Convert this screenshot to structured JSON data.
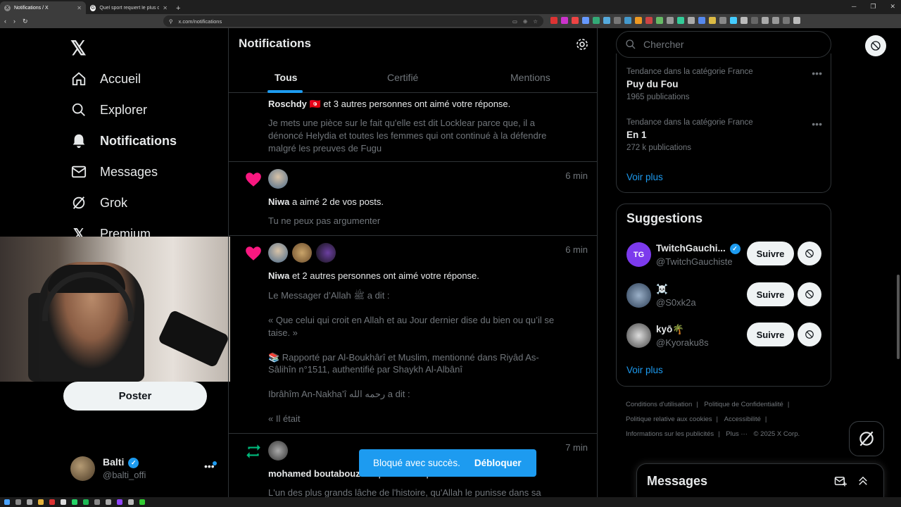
{
  "browser": {
    "tabs": [
      {
        "title": "Notifications / X",
        "active": true
      },
      {
        "title": "Quel sport requiert le plus de cardio",
        "active": false
      }
    ],
    "url": "x.com/notifications"
  },
  "nav": {
    "items": [
      {
        "label": "Accueil",
        "icon": "home-icon"
      },
      {
        "label": "Explorer",
        "icon": "search-icon"
      },
      {
        "label": "Notifications",
        "icon": "bell-icon",
        "active": true
      },
      {
        "label": "Messages",
        "icon": "mail-icon"
      },
      {
        "label": "Grok",
        "icon": "grok-icon"
      },
      {
        "label": "Premium",
        "icon": "x-icon"
      }
    ],
    "post_label": "Poster",
    "account": {
      "name": "Balti",
      "handle": "@balti_offi",
      "verified": true
    }
  },
  "notifications": {
    "title": "Notifications",
    "tabs": [
      "Tous",
      "Certifié",
      "Mentions"
    ],
    "active_tab": "Tous",
    "items": [
      {
        "type": "like",
        "actor": "Roschdy",
        "flag": "🇹🇳",
        "action": " et 3 autres personnes ont aimé votre réponse.",
        "time": "",
        "body": "Je mets une pièce sur le fait qu'elle est dit Locklear parce que, il a dénoncé Helydia et toutes les femmes qui ont continué à la défendre malgré les preuves de Fugu"
      },
      {
        "type": "like",
        "actor": "Niwa",
        "action": " a aimé 2 de vos posts.",
        "time": "6 min",
        "body": "Tu ne peux pas argumenter"
      },
      {
        "type": "like",
        "actor": "Niwa",
        "action": " et 2 autres personnes ont aimé votre réponse.",
        "time": "6 min",
        "body": "Le Messager d’Allah ﷺ a dit :\n\n« Que celui qui croit en Allah et au Jour dernier dise du bien ou qu’il se taise. »\n\n📚 Rapporté par Al-Boukhârî et Muslim, mentionné dans Riyâd As-Sâlihîn n°1511, authentifié par Shaykh Al-Albânî\n\nIbrâhîm An-Nakha’î رحمه الله a dit :\n\n« Il était"
      },
      {
        "type": "repost",
        "actor": "mohamed boutabouz",
        "action": " a reposté votre post.",
        "time": "7 min",
        "body": "L'un des plus grands lâche de l'histoire, qu'Allah le punisse dans sa"
      }
    ]
  },
  "toast": {
    "message": "Bloqué avec succès.",
    "action": "Débloquer"
  },
  "sidebar": {
    "search_placeholder": "Chercher",
    "trends": [
      {
        "category": "Tendance dans la catégorie France",
        "name": "Puy du Fou",
        "count": "1965 publications"
      },
      {
        "category": "Tendance dans la catégorie France",
        "name": "En 1",
        "count": "272 k publications"
      }
    ],
    "trends_more": "Voir plus",
    "suggestions_title": "Suggestions",
    "suggestions": [
      {
        "name": "TwitchGauchi...",
        "handle": "@TwitchGauchiste",
        "verified": true,
        "follow": "Suivre"
      },
      {
        "name": "☠️",
        "handle": "@S0xk2a",
        "verified": false,
        "follow": "Suivre"
      },
      {
        "name": "kyō🌴",
        "handle": "@Kyoraku8s",
        "verified": false,
        "follow": "Suivre"
      }
    ],
    "suggestions_more": "Voir plus",
    "footer": [
      "Conditions d'utilisation",
      "Politique de Confidentialité",
      "Politique relative aux cookies",
      "Accessibilité",
      "Informations sur les publicités",
      "Plus ···",
      "© 2025 X Corp."
    ],
    "messages_title": "Messages"
  },
  "colors": {
    "accent": "#1d9bf0",
    "like": "#f91880",
    "repost": "#00ba7c",
    "background": "#000000"
  }
}
